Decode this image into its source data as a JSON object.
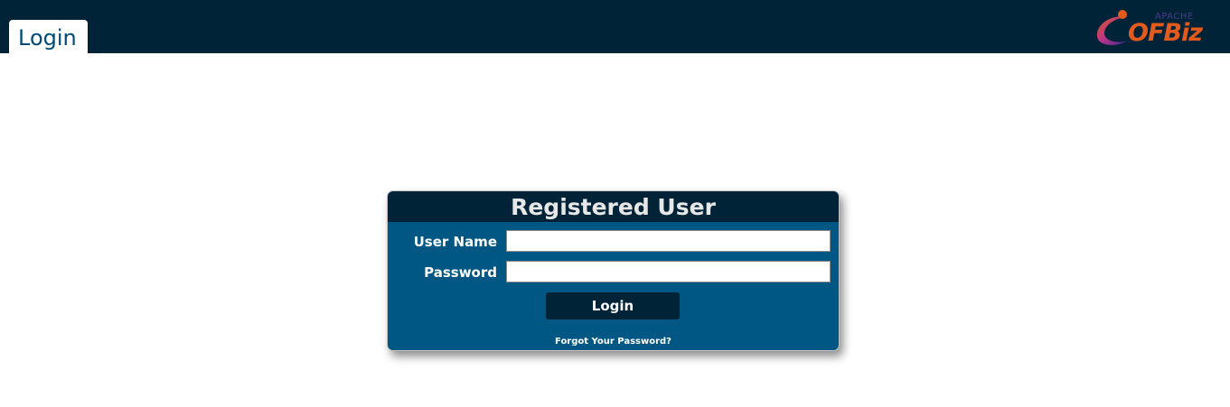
{
  "header": {
    "tab_label": "Login",
    "logo": {
      "apache_text": "APACHE",
      "ofbiz_text": "OFBiz",
      "icon": "ofbiz-logo-icon"
    },
    "background_color": "#002337"
  },
  "login_box": {
    "title": "Registered User",
    "username_label": "User Name",
    "username_value": "",
    "password_label": "Password",
    "password_value": "",
    "submit_label": "Login",
    "forgot_password_link": "Forgot Your Password?",
    "colors": {
      "title_bar": "#002337",
      "body": "#005784",
      "button": "#002337"
    }
  }
}
